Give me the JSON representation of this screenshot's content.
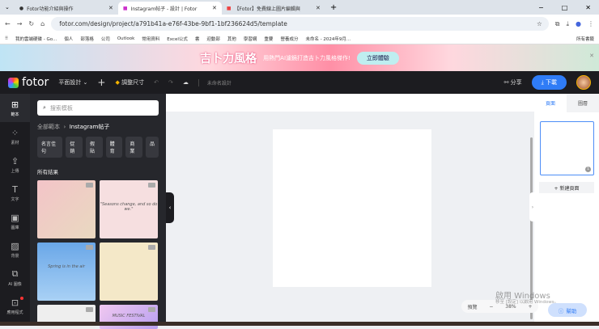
{
  "browser": {
    "tabs": [
      "Fotor功能介紹與操作",
      "Instagram帖子 - 設計 | Fotor",
      "【Fotor】免費線上圖片編輯與"
    ],
    "url": "fotor.com/design/project/a791b41a-e76f-43be-9bf1-1bf236624d5/template",
    "bookmarks": [
      "我的雲端硬碟 - Go...",
      "個人",
      "部落格",
      "公司",
      "Outlook",
      "常用資料",
      "Excel公式",
      "書",
      "迎動部",
      "其他",
      "學習網",
      "重要",
      "營養成分",
      "未命名 - 2024年9月...",
      "所有書籤"
    ]
  },
  "banner": {
    "title": "吉卜力風格",
    "subtitle": "用熱門AI濾鏡打造吉卜力風格傑作!",
    "cta": "立即體驗"
  },
  "header": {
    "logo": "fotor",
    "design_type": "平面設計",
    "resize": "調整尺寸",
    "doc_name": "未命名設計",
    "share": "分享",
    "download": "下載"
  },
  "rail": [
    {
      "icon": "template-icon",
      "label": "範本"
    },
    {
      "icon": "elements-icon",
      "label": "素材"
    },
    {
      "icon": "upload-icon",
      "label": "上傳"
    },
    {
      "icon": "text-icon",
      "label": "文字"
    },
    {
      "icon": "image-icon",
      "label": "圖庫"
    },
    {
      "icon": "background-icon",
      "label": "背景"
    },
    {
      "icon": "ai-image-icon",
      "label": "AI 圖像"
    },
    {
      "icon": "apps-icon",
      "label": "應用程式"
    }
  ],
  "panel": {
    "search_placeholder": "搜索模板",
    "crumb_root": "全部範本",
    "crumb_current": "Instagram帖子",
    "chips": [
      "名言佳句",
      "促銷",
      "假貼",
      "體育",
      "商業",
      "品"
    ],
    "results_label": "所有結果",
    "thumbs": [
      {
        "text": "",
        "bg": "linear-gradient(135deg,#f3c4c8,#e9d9c0)"
      },
      {
        "text": "\"Seasons change, and so do we.\"",
        "bg": "#f6dfe0"
      },
      {
        "text": "Spring is in the air",
        "bg": "linear-gradient(#6aa7e8,#a9d1f5)"
      },
      {
        "text": "",
        "bg": "#f4e8c8"
      },
      {
        "text": "",
        "bg": "#eee"
      },
      {
        "text": "MUSIC FESTIVAL",
        "bg": "linear-gradient(135deg,#f0c8f0,#b9a0f0)"
      }
    ]
  },
  "right": {
    "tabs": [
      "頁面",
      "圖層"
    ],
    "page_number": "1",
    "new_page": "+ 新建頁面"
  },
  "zoom": {
    "preview": "預覽",
    "minus": "−",
    "value": "38%",
    "plus": "+"
  },
  "help": "幫助",
  "watermark": {
    "title": "啟用 Windows",
    "sub": "移至 [設定] 以啟用 Windows。"
  }
}
